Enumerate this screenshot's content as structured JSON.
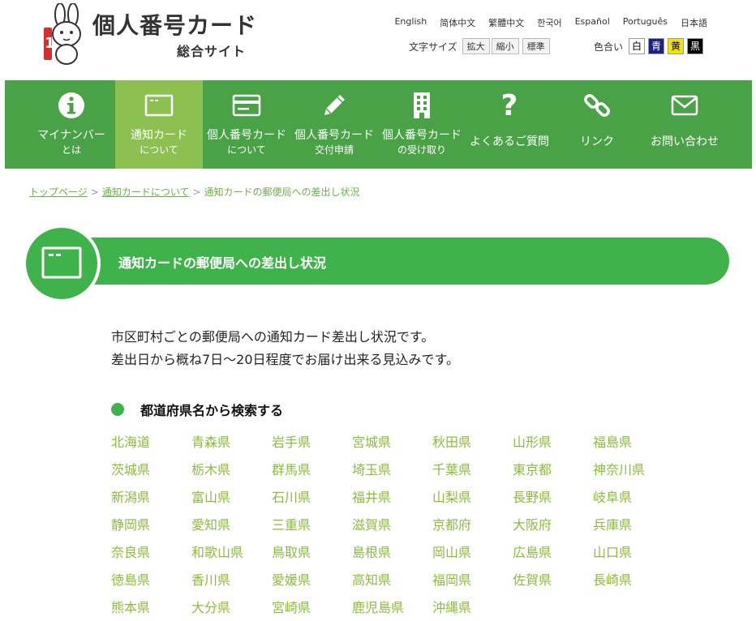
{
  "header": {
    "site_title": "個人番号カード",
    "site_subtitle": "総合サイト",
    "languages": [
      "English",
      "简体中文",
      "繁體中文",
      "한국어",
      "Español",
      "Português",
      "日本語"
    ],
    "font_size": {
      "label": "文字サイズ",
      "buttons": [
        "拡大",
        "縮小",
        "標準"
      ]
    },
    "color_scheme": {
      "label": "色合い",
      "buttons": [
        "白",
        "青",
        "黄",
        "黒"
      ]
    }
  },
  "nav": {
    "items": [
      {
        "line1": "マイナンバー",
        "line2": "とは",
        "icon": "info-icon"
      },
      {
        "line1": "通知カード",
        "line2": "について",
        "icon": "card-icon"
      },
      {
        "line1": "個人番号カード",
        "line2": "について",
        "icon": "id-card-icon"
      },
      {
        "line1": "個人番号カード",
        "line2": "交付申請",
        "icon": "pencil-icon"
      },
      {
        "line1": "個人番号カード",
        "line2": "の受け取り",
        "icon": "building-icon"
      },
      {
        "line1": "よくあるご質問",
        "line2": "",
        "icon": "question-icon"
      },
      {
        "line1": "リンク",
        "line2": "",
        "icon": "link-icon"
      },
      {
        "line1": "お問い合わせ",
        "line2": "",
        "icon": "mail-icon"
      }
    ],
    "active_index": 1
  },
  "breadcrumb": {
    "home": "トップページ",
    "parent": "通知カードについて",
    "current": "通知カードの郵便局への差出し状況"
  },
  "page_title": "通知カードの郵便局への差出し状況",
  "intro": {
    "line1": "市区町村ごとの郵便局への通知カード差出し状況です。",
    "line2": "差出日から概ね7日～20日程度でお届け出来る見込みです。"
  },
  "section": {
    "heading": "都道府県名から検索する",
    "prefectures": [
      "北海道",
      "青森県",
      "岩手県",
      "宮城県",
      "秋田県",
      "山形県",
      "福島県",
      "茨城県",
      "栃木県",
      "群馬県",
      "埼玉県",
      "千葉県",
      "東京都",
      "神奈川県",
      "新潟県",
      "富山県",
      "石川県",
      "福井県",
      "山梨県",
      "長野県",
      "岐阜県",
      "静岡県",
      "愛知県",
      "三重県",
      "滋賀県",
      "京都府",
      "大阪府",
      "兵庫県",
      "奈良県",
      "和歌山県",
      "鳥取県",
      "島根県",
      "岡山県",
      "広島県",
      "山口県",
      "徳島県",
      "香川県",
      "愛媛県",
      "高知県",
      "福岡県",
      "佐賀県",
      "長崎県",
      "熊本県",
      "大分県",
      "宮崎県",
      "鹿児島県",
      "沖縄県"
    ]
  },
  "colors": {
    "nav_green": "#4aa247",
    "nav_active": "#8cc152",
    "title_green": "#3fb24b",
    "link_green": "#8bbb3e"
  }
}
